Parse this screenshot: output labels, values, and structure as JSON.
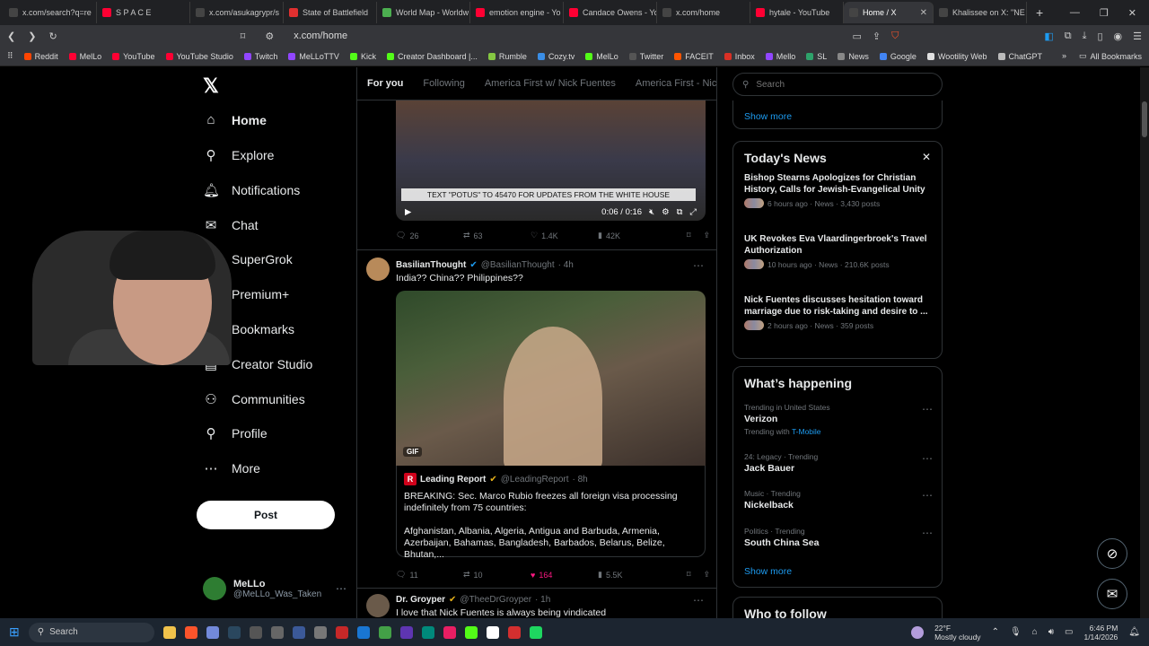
{
  "browser": {
    "tabs": [
      {
        "title": "x.com/search?q=re",
        "color": "#444"
      },
      {
        "title": "S P A C E",
        "color": "#ff0033"
      },
      {
        "title": "x.com/asukagrypr/s",
        "color": "#444"
      },
      {
        "title": "State of Battlefield",
        "color": "#e03030"
      },
      {
        "title": "World Map - Worldw",
        "color": "#4caf50"
      },
      {
        "title": "emotion engine - Yo",
        "color": "#ff0033"
      },
      {
        "title": "Candace Owens - Yo",
        "color": "#ff0033"
      },
      {
        "title": "x.com/home",
        "color": "#444"
      },
      {
        "title": "hytale - YouTube",
        "color": "#ff0033"
      },
      {
        "title": "Home / X",
        "color": "#444",
        "active": true
      },
      {
        "title": "Khalissee on X: \"NE",
        "color": "#444"
      }
    ],
    "url": "x.com/home",
    "bookmarks": [
      {
        "label": "Reddit",
        "color": "#ff4500"
      },
      {
        "label": "MelLo",
        "color": "#ff0033"
      },
      {
        "label": "YouTube",
        "color": "#ff0033"
      },
      {
        "label": "YouTube Studio",
        "color": "#ff0033"
      },
      {
        "label": "Twitch",
        "color": "#9146ff"
      },
      {
        "label": "MeLLoTTV",
        "color": "#9146ff"
      },
      {
        "label": "Kick",
        "color": "#53fc18"
      },
      {
        "label": "Creator Dashboard |...",
        "color": "#53fc18"
      },
      {
        "label": "Rumble",
        "color": "#85c742"
      },
      {
        "label": "Cozy.tv",
        "color": "#3a8ee6"
      },
      {
        "label": "MelLo",
        "color": "#53fc18"
      },
      {
        "label": "Twitter",
        "color": "#555"
      },
      {
        "label": "FACEIT",
        "color": "#ff5500"
      },
      {
        "label": "Inbox",
        "color": "#d93025"
      },
      {
        "label": "Mello",
        "color": "#9146ff"
      },
      {
        "label": "SL",
        "color": "#2ea36b"
      },
      {
        "label": "News",
        "color": "#888"
      },
      {
        "label": "Google",
        "color": "#4285f4"
      },
      {
        "label": "Wootility Web",
        "color": "#e0e0e0"
      },
      {
        "label": "ChatGPT",
        "color": "#bbb"
      }
    ],
    "all_bookmarks": "All Bookmarks"
  },
  "nav": {
    "items": [
      {
        "label": "Home",
        "icon": "home-icon",
        "glyph": "⌂"
      },
      {
        "label": "Explore",
        "icon": "search-icon",
        "glyph": "⚲"
      },
      {
        "label": "Notifications",
        "icon": "bell-icon",
        "glyph": "🔔︎"
      },
      {
        "label": "Chat",
        "icon": "mail-icon",
        "glyph": "✉"
      },
      {
        "label": "SuperGrok",
        "icon": "grok-icon",
        "glyph": "⊘"
      },
      {
        "label": "Premium+",
        "icon": "x-icon",
        "glyph": "✕"
      },
      {
        "label": "Bookmarks",
        "icon": "bookmark-icon",
        "glyph": "⌑"
      },
      {
        "label": "Creator Studio",
        "icon": "chart-icon",
        "glyph": "▤"
      },
      {
        "label": "Communities",
        "icon": "people-icon",
        "glyph": "⚇"
      },
      {
        "label": "Profile",
        "icon": "person-icon",
        "glyph": "⚲"
      },
      {
        "label": "More",
        "icon": "more-circle-icon",
        "glyph": "⋯"
      }
    ],
    "post_label": "Post",
    "account": {
      "name": "MeLLo",
      "handle": "@MeLLo_Was_Taken"
    }
  },
  "feed": {
    "tabs": [
      "For you",
      "Following",
      "America First w/ Nick Fuentes",
      "America First - Nick Fu"
    ],
    "tweet1": {
      "video_caption": "TEXT \"POTUS\" TO 45470 FOR UPDATES FROM THE WHITE HOUSE",
      "video_time": "0:06 / 0:16",
      "replies": "26",
      "reposts": "63",
      "likes": "1.4K",
      "views": "42K"
    },
    "tweet2": {
      "name": "BasilianThought",
      "handle": "@BasilianThought",
      "time": "· 4h",
      "text": "India?? China?? Philippines??",
      "gif_label": "GIF",
      "quote": {
        "name": "Leading Report",
        "handle": "@LeadingReport",
        "time": "· 8h",
        "text": "BREAKING: Sec. Marco Rubio freezes all foreign visa processing indefinitely from 75 countries:\n\nAfghanistan, Albania, Algeria, Antigua and Barbuda, Armenia, Azerbaijan, Bahamas, Bangladesh, Barbados, Belarus, Belize, Bhutan,..."
      },
      "replies": "11",
      "reposts": "10",
      "likes": "164",
      "views": "5.5K"
    },
    "tweet3": {
      "name": "Dr. Groyper",
      "handle": "@TheeDrGroyper",
      "time": "· 1h",
      "text": "I love that Nick Fuentes is always being vindicated"
    }
  },
  "sidebar": {
    "search_placeholder": "Search",
    "show_more": "Show more",
    "news": {
      "title": "Today's News",
      "items": [
        {
          "title": "Bishop Stearns Apologizes for Christian History, Calls for Jewish-Evangelical Unity",
          "meta": "6 hours ago · News · 3,430 posts"
        },
        {
          "title": "UK Revokes Eva Vlaardingerbroek's Travel Authorization",
          "meta": "10 hours ago · News · 210.6K posts"
        },
        {
          "title": "Nick Fuentes discusses hesitation toward marriage due to risk-taking and desire to ...",
          "meta": "2 hours ago · News · 359 posts"
        }
      ]
    },
    "happening": {
      "title": "What’s happening",
      "trends": [
        {
          "context": "Trending in United States",
          "name": "Verizon",
          "with_prefix": "Trending with",
          "with": "T-Mobile"
        },
        {
          "context": "24: Legacy · Trending",
          "name": "Jack Bauer"
        },
        {
          "context": "Music · Trending",
          "name": "Nickelback"
        },
        {
          "context": "Politics · Trending",
          "name": "South China Sea"
        }
      ],
      "show_more": "Show more"
    },
    "who_to_follow": "Who to follow"
  },
  "taskbar": {
    "search": "Search",
    "weather_temp": "22°F",
    "weather_desc": "Mostly cloudy",
    "time": "6:46 PM",
    "date": "1/14/2026"
  }
}
